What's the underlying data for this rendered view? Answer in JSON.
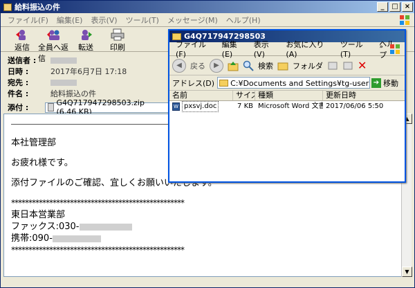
{
  "mail": {
    "title": "給料振込の件",
    "menu": [
      "ファイル(F)",
      "編集(E)",
      "表示(V)",
      "ツール(T)",
      "メッセージ(M)",
      "ヘルプ(H)"
    ],
    "toolbar": {
      "reply": "返信",
      "reply_all": "全員へ返信",
      "forward": "転送",
      "print": "印刷"
    },
    "headers": {
      "from_label": "送信者 :",
      "date_label": "日時 :",
      "date_value": "2017年6月7日 17:18",
      "to_label": "宛先 :",
      "subject_label": "件名 :",
      "subject_value": "給料振込の件",
      "attach_label": "添付 :",
      "attach_value": "G4Q717947298503.zip (6.46 KB)"
    },
    "body": {
      "greeting": "本社管理部",
      "line1": "お疲れ様です。",
      "line2": "添付ファイルのご確認、宜しくお願いいたします。",
      "stars": "**************************************************",
      "dept": "東日本営業部",
      "fax": "ファックス:030-",
      "mobile": "携帯:090-"
    }
  },
  "explorer": {
    "title": "G4Q717947298503",
    "menu": [
      "ファイル(F)",
      "編集(E)",
      "表示(V)",
      "お気に入り(A)",
      "ツール(T)",
      "ヘルプ"
    ],
    "toolbar": {
      "back": "戻る",
      "search": "検索",
      "folders": "フォルダ"
    },
    "address_label": "アドレス(D)",
    "address_value": "C:¥Documents and Settings¥tg-user¥デスクトップ¥G",
    "go_label": "移動",
    "columns": {
      "name": "名前",
      "size": "サイズ",
      "type": "種類",
      "modified": "更新日時"
    },
    "files": [
      {
        "name": "pxsvj.doc",
        "size": "7 KB",
        "type": "Microsoft Word 文書",
        "modified": "2017/06/06 5:50"
      }
    ]
  }
}
